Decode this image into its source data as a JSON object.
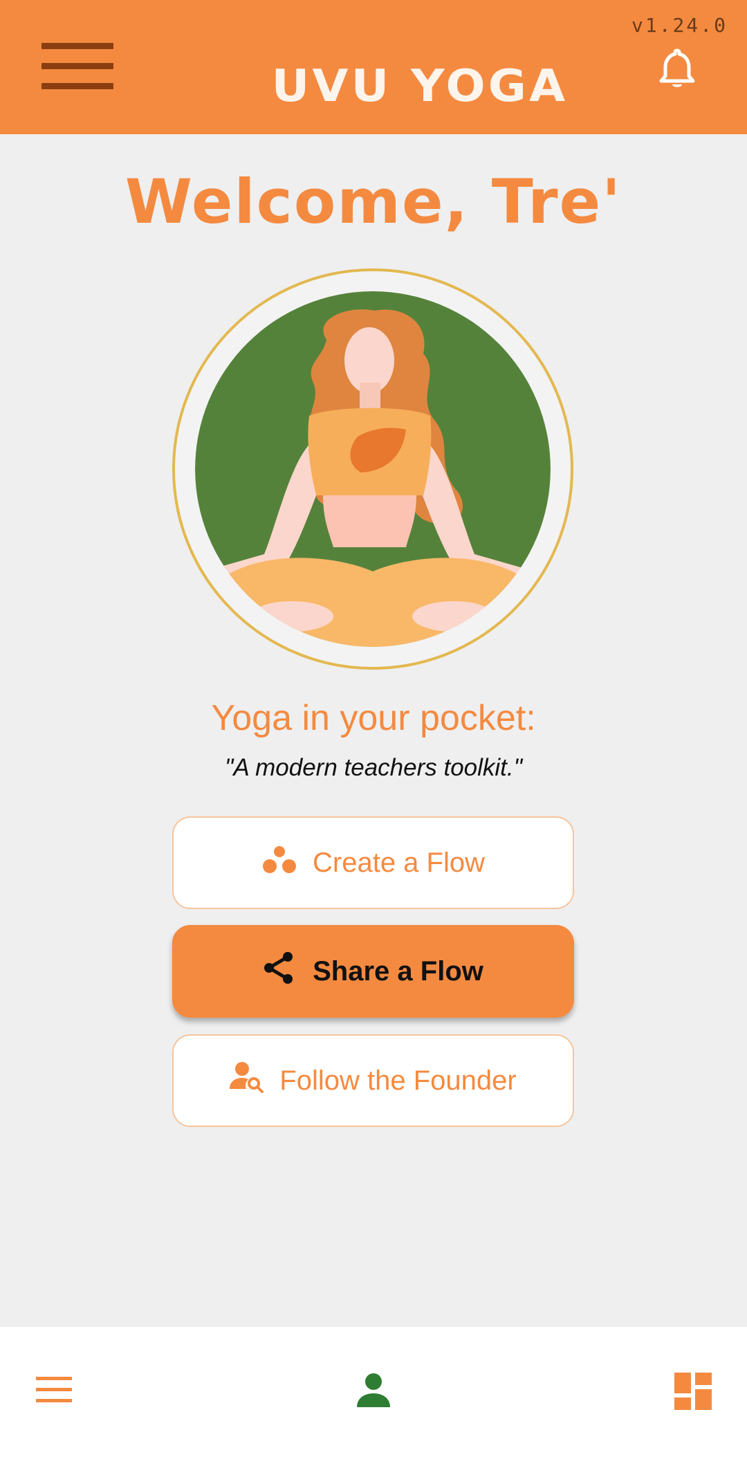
{
  "app": {
    "version": "v1.24.0",
    "logo_text": "UVU YOGA"
  },
  "greeting": "Welcome, Tre'",
  "tagline": "Yoga in your pocket:",
  "subtagline": "\"A modern teachers toolkit.\"",
  "actions": [
    {
      "label": "Create a Flow",
      "icon": "dots-icon"
    },
    {
      "label": "Share a Flow",
      "icon": "share-icon"
    },
    {
      "label": "Follow the Founder",
      "icon": "person-search-icon"
    }
  ],
  "bottom_nav": [
    {
      "icon": "menu-icon"
    },
    {
      "icon": "person-icon"
    },
    {
      "icon": "dashboard-icon"
    }
  ],
  "colors": {
    "primary": "#f48a40",
    "menu_dark": "#8a3e10",
    "background": "#efefef",
    "avatar_green": "#55823a",
    "ring_gold": "#e3b850",
    "profile_green": "#2e7d32"
  }
}
